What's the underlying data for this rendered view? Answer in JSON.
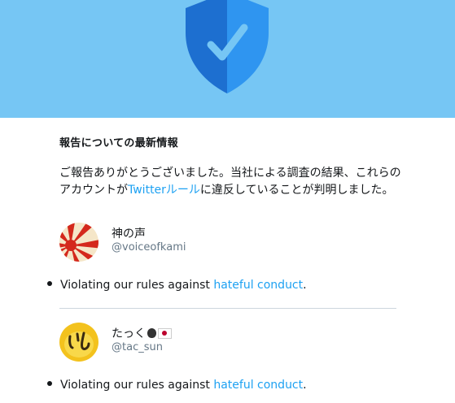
{
  "header": {
    "shield_icon": "shield-check-icon",
    "colors": {
      "banner": "#76c6f4",
      "shield_left": "#1d6fd0",
      "shield_right": "#2f95f0",
      "check": "#76c6f4"
    }
  },
  "report": {
    "heading": "報告についての最新情報",
    "body_before_link": "ご報告ありがとうございました。当社による調査の結果、これらのアカウントが",
    "rules_link": "Twitterルール",
    "body_after_link": "に違反していることが判明しました。"
  },
  "accounts": [
    {
      "name": "神の声",
      "handle": "@voiceofkami",
      "violation_prefix": "Violating our rules against ",
      "violation_link": "hateful conduct",
      "violation_suffix": "."
    },
    {
      "name": "たっく",
      "handle": "@tac_sun",
      "name_emojis": [
        "apple-emoji",
        "japan-flag-emoji"
      ],
      "violation_prefix": "Violating our rules against ",
      "violation_link": "hateful conduct",
      "violation_suffix": "."
    }
  ],
  "colors": {
    "link": "#1da1f2",
    "text": "#14171a",
    "secondary_text": "#657786",
    "divider": "#ccd6dd"
  }
}
